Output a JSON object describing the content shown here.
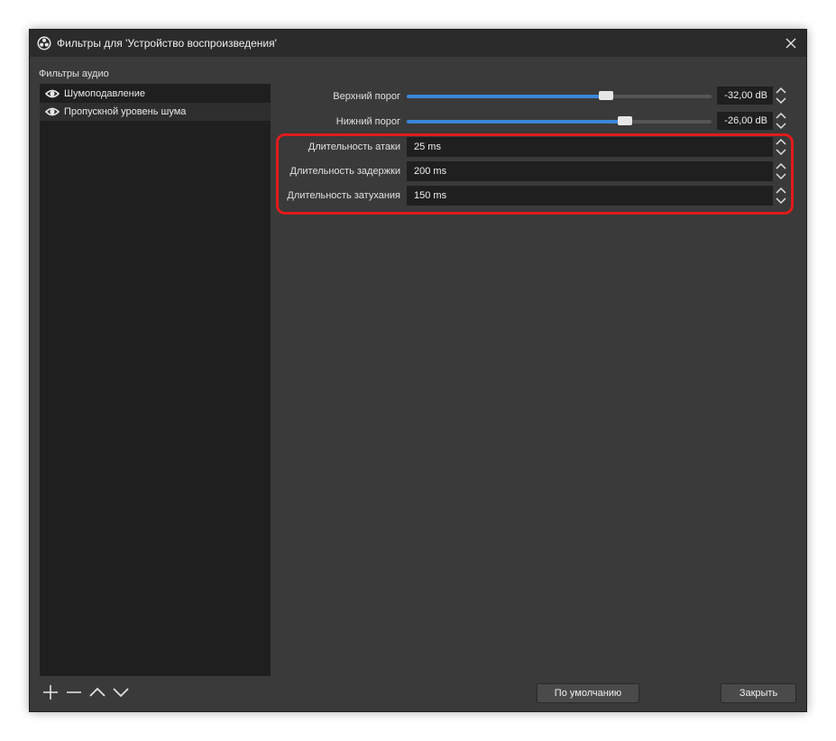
{
  "window": {
    "title": "Фильтры для 'Устройство воспроизведения'"
  },
  "sidebar": {
    "section_label": "Фильтры аудио",
    "items": [
      {
        "label": "Шумоподавление",
        "visible": true,
        "selected": false
      },
      {
        "label": "Пропускной уровень шума",
        "visible": true,
        "selected": true
      }
    ]
  },
  "properties": {
    "upper_threshold": {
      "label": "Верхний порог",
      "value": "-32,00 dB",
      "slider_fraction": 0.655
    },
    "lower_threshold": {
      "label": "Нижний порог",
      "value": "-26,00 dB",
      "slider_fraction": 0.715
    },
    "attack": {
      "label": "Длительность атаки",
      "value": "25 ms"
    },
    "hold": {
      "label": "Длительность задержки",
      "value": "200 ms"
    },
    "release": {
      "label": "Длительность затухания",
      "value": "150 ms"
    }
  },
  "footer": {
    "defaults_label": "По умолчанию",
    "close_label": "Закрыть"
  },
  "colors": {
    "accent": "#3a87d9",
    "highlight": "#e01b1b"
  }
}
